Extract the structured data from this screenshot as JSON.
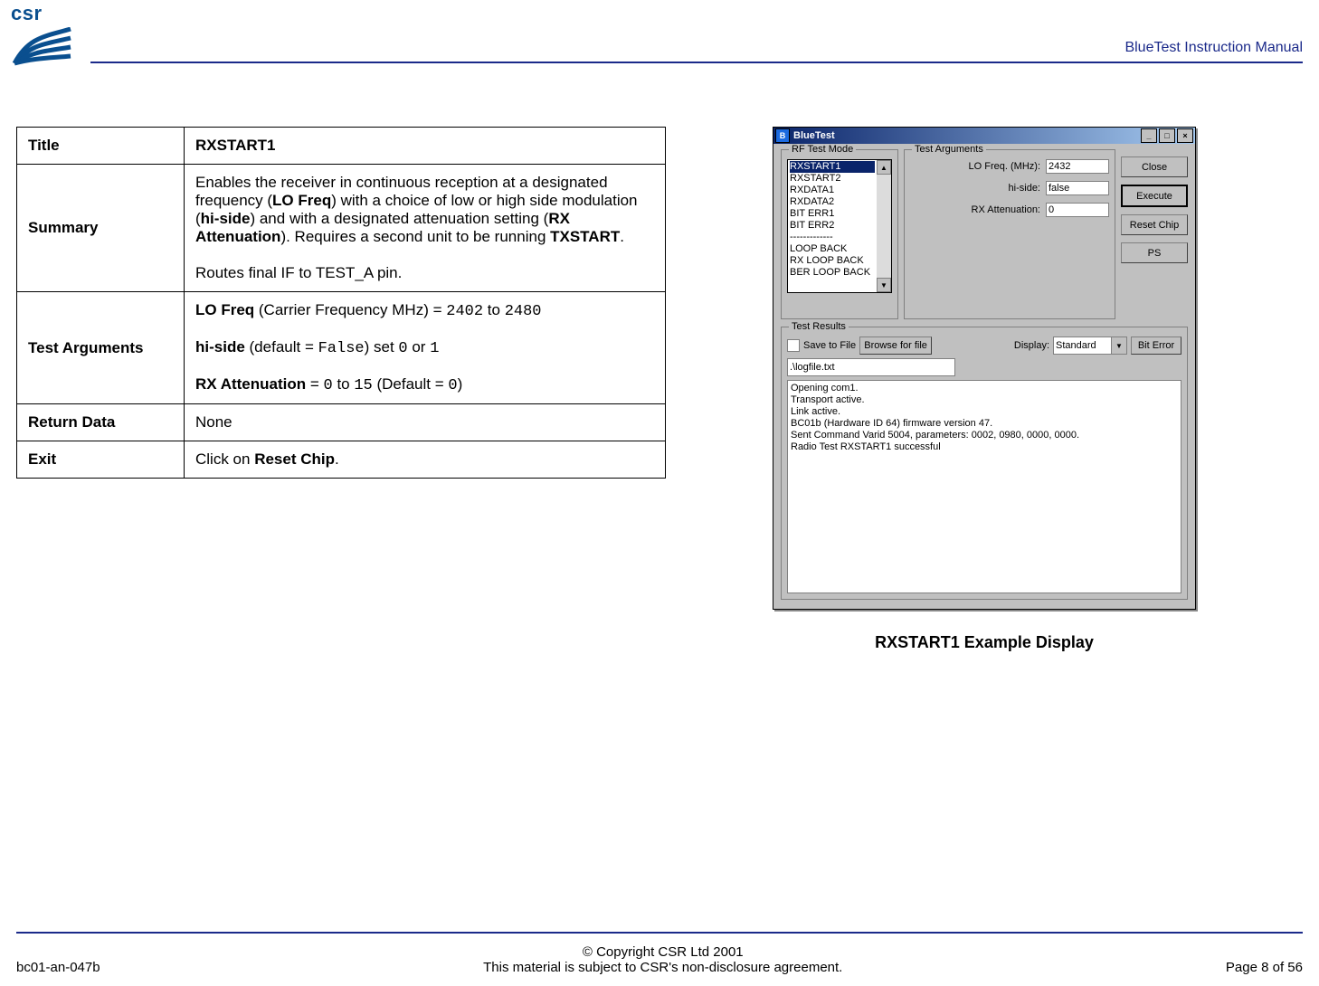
{
  "header": {
    "logo_text": "csr",
    "doc_title": "BlueTest Instruction Manual"
  },
  "table": {
    "rows": [
      {
        "key": "Title",
        "value_html": "<b>RXSTART1</b>"
      },
      {
        "key": "Summary",
        "value_html": "Enables the receiver in continuous reception at a designated frequency (<b>LO Freq</b>) with a choice of low or high side modulation (<b>hi-side</b>)  and with a designated attenuation setting (<b>RX Attenuation</b>). Requires a second unit to be running <b>TXSTART</b>.<br><br>Routes final IF to TEST_A pin."
      },
      {
        "key": "Test Arguments",
        "value_html": "<b>LO Freq</b> (Carrier Frequency MHz) = <span class='mono'>2402</span> to <span class='mono'>2480</span><br><br><b>hi-side</b> (default = <span class='mono'>False</span>) set <span class='mono'>0</span> or <span class='mono'>1</span><br><br><b>RX Attenuation</b> = <span class='mono'>0</span> to <span class='mono'>15</span> (Default = <span class='mono'>0</span>)"
      },
      {
        "key": "Return Data",
        "value_html": "None"
      },
      {
        "key": "Exit",
        "value_html": "Click on <b>Reset Chip</b>."
      }
    ]
  },
  "app": {
    "title": "BlueTest",
    "groups": {
      "rf_mode_title": "RF Test Mode",
      "args_title": "Test Arguments",
      "results_title": "Test Results"
    },
    "rf_items": [
      "RXSTART1",
      "RXSTART2",
      "RXDATA1",
      "RXDATA2",
      "BIT ERR1",
      "BIT ERR2",
      "-------------",
      "LOOP BACK",
      "RX LOOP BACK",
      "BER LOOP BACK"
    ],
    "rf_selected_index": 0,
    "args": {
      "lo_label": "LO Freq. (MHz):",
      "lo_value": "2432",
      "hi_label": "hi-side:",
      "hi_value": "false",
      "att_label": "RX Attenuation:",
      "att_value": "0"
    },
    "buttons": {
      "close": "Close",
      "execute": "Execute",
      "reset": "Reset Chip",
      "ps": "PS"
    },
    "results": {
      "save_label": "Save to File",
      "browse_label": "Browse for file",
      "display_label": "Display:",
      "display_value": "Standard",
      "biterror_label": "Bit Error",
      "path": ".\\logfile.txt",
      "console": "Opening com1.\nTransport active.\nLink active.\nBC01b (Hardware ID 64) firmware version 47.\nSent Command Varid 5004, parameters: 0002, 0980, 0000, 0000.\nRadio Test RXSTART1 successful"
    }
  },
  "caption": "RXSTART1 Example Display",
  "footer": {
    "doc_id": "bc01-an-047b",
    "copyright": "© Copyright CSR Ltd 2001",
    "nda": "This material is subject to CSR's non-disclosure agreement.",
    "page": "Page 8 of 56"
  }
}
